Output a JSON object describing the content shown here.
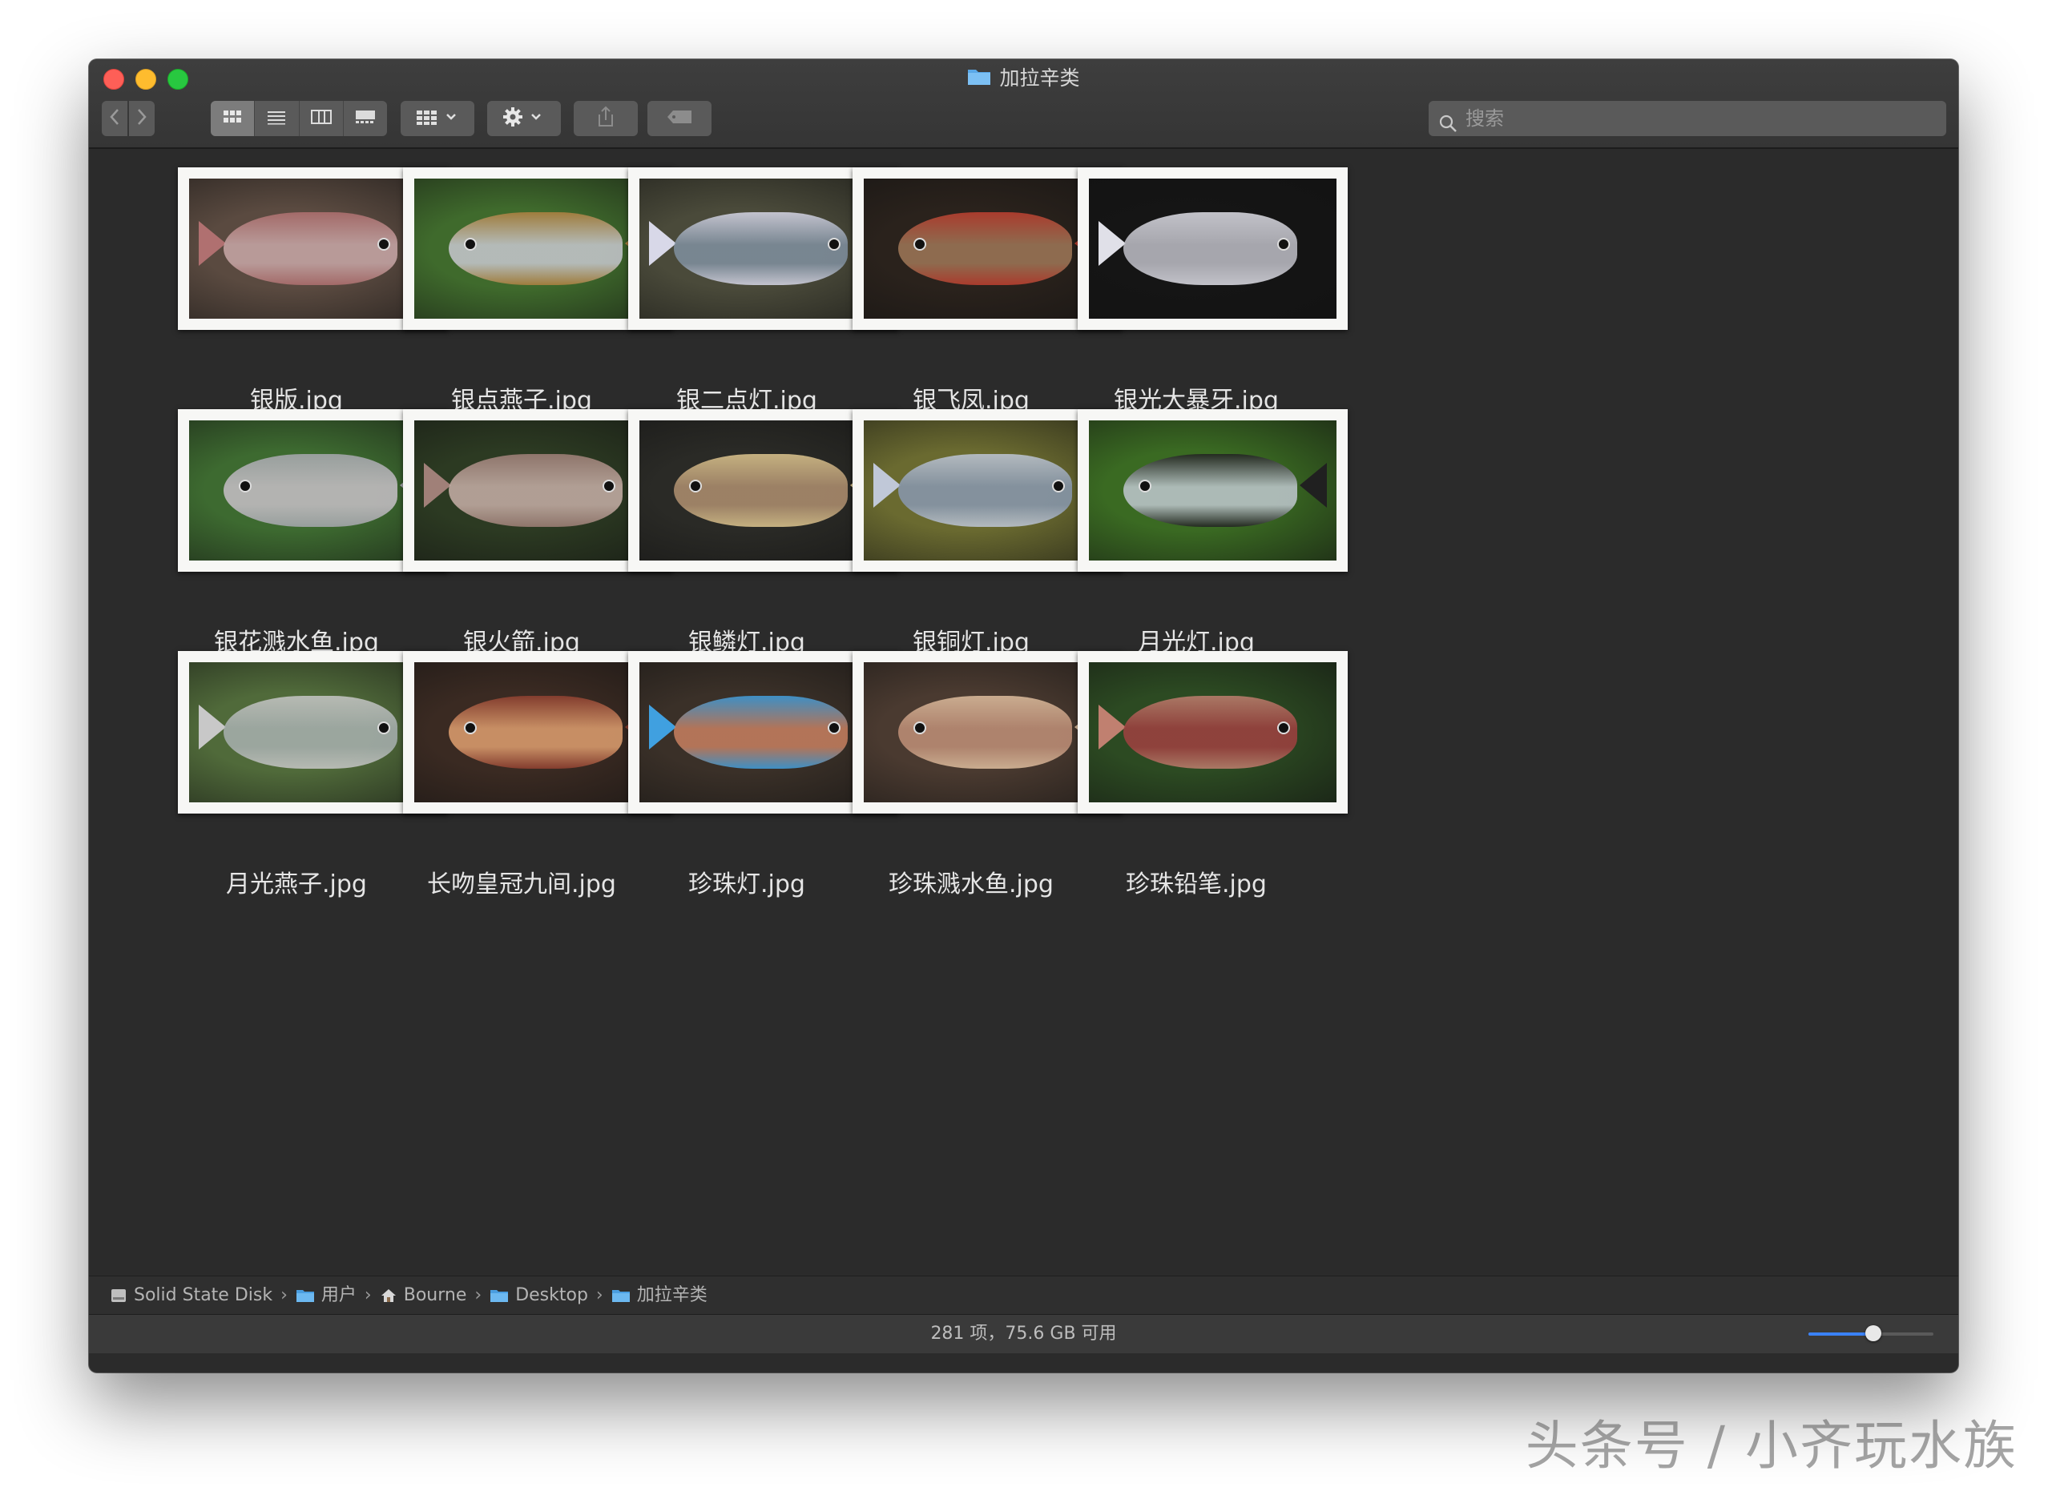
{
  "window": {
    "title": "加拉辛类"
  },
  "toolbar": {
    "back_icon": "chevron-left-icon",
    "forward_icon": "chevron-right-icon",
    "view_modes": [
      "icon-view",
      "list-view",
      "column-view",
      "gallery-view"
    ],
    "active_view": "icon-view",
    "group_icon": "grid-dropdown-icon",
    "action_icon": "gear-dropdown-icon",
    "share_icon": "share-icon",
    "tag_icon": "tag-icon",
    "search_placeholder": "搜索"
  },
  "files": [
    {
      "name": "银版.jpg",
      "bg": "#5a4a40",
      "fish": "#c9a8a8",
      "accent": "#b07070"
    },
    {
      "name": "银点燕子.jpg",
      "bg": "#3f6a2c",
      "fish": "#c8c8d0",
      "accent": "#b08040"
    },
    {
      "name": "银二点灯.jpg",
      "bg": "#4a4a3a",
      "fish": "#8090a0",
      "accent": "#d8d8e8"
    },
    {
      "name": "银飞凤.jpg",
      "bg": "#2a221c",
      "fish": "#a07858",
      "accent": "#c04030"
    },
    {
      "name": "银光大暴牙.jpg",
      "bg": "#151515",
      "fish": "#c0c0c8",
      "accent": "#e0e0e8"
    },
    {
      "name": "银花溅水鱼.jpg",
      "bg": "#3d6a30",
      "fish": "#c8c0c8",
      "accent": "#a8a8b0"
    },
    {
      "name": "银火箭.jpg",
      "bg": "#2c3a22",
      "fish": "#c8b0a8",
      "accent": "#a08078"
    },
    {
      "name": "银鳞灯.jpg",
      "bg": "#2a2a26",
      "fish": "#b09070",
      "accent": "#e0c890"
    },
    {
      "name": "银铜灯.jpg",
      "bg": "#6a6a30",
      "fish": "#8898b0",
      "accent": "#c0c8d8"
    },
    {
      "name": "月光灯.jpg",
      "bg": "#3a6a22",
      "fish": "#c0c8d0",
      "accent": "#202020"
    },
    {
      "name": "月光燕子.jpg",
      "bg": "#506a3a",
      "fish": "#a8b0b0",
      "accent": "#c8c8c8"
    },
    {
      "name": "长吻皇冠九间.jpg",
      "bg": "#3a2a22",
      "fish": "#e0a070",
      "accent": "#904030"
    },
    {
      "name": "珍珠灯.jpg",
      "bg": "#3a3028",
      "fish": "#c88060",
      "accent": "#40a0e0"
    },
    {
      "name": "珍珠溅水鱼.jpg",
      "bg": "#4a3a30",
      "fish": "#c09078",
      "accent": "#e0c0a0"
    },
    {
      "name": "珍珠铅笔.jpg",
      "bg": "#2c4a22",
      "fish": "#a04040",
      "accent": "#c08070"
    }
  ],
  "pathbar": [
    {
      "label": "Solid State Disk",
      "icon": "disk-icon"
    },
    {
      "label": "用户",
      "icon": "folder-icon"
    },
    {
      "label": "Bourne",
      "icon": "home-icon"
    },
    {
      "label": "Desktop",
      "icon": "folder-icon"
    },
    {
      "label": "加拉辛类",
      "icon": "folder-icon"
    }
  ],
  "status": {
    "text": "281 项，75.6 GB 可用",
    "icon_size_slider": 0.52
  },
  "watermark": "头条号 / 小齐玩水族",
  "colors": {
    "accent": "#3a82f7",
    "close": "#fe5f57",
    "minimize": "#febc2e",
    "maximize": "#28c840"
  }
}
